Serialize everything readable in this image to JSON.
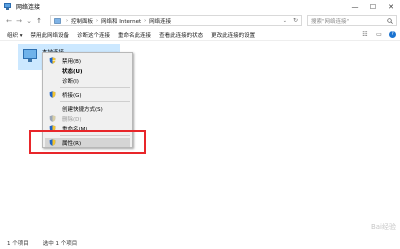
{
  "window": {
    "title": "网络连接",
    "minimize": "—",
    "maximize": "☐",
    "close": "✕"
  },
  "nav": {
    "back": "←",
    "forward": "→",
    "recent": "⌄",
    "up": "↑"
  },
  "address": {
    "crumbs": [
      "控制面板",
      "网络和 Internet",
      "网络连接"
    ],
    "separator": "›"
  },
  "search": {
    "placeholder": "搜索\"网络连接\""
  },
  "toolbar": {
    "items": [
      "组织 ▾",
      "禁用此网络设备",
      "诊断这个连接",
      "重命名此连接",
      "查看此连接的状态",
      "更改此连接的设置"
    ],
    "view_label": "☷",
    "pane_label": "▭",
    "help_label": "?"
  },
  "adapter": {
    "name": "本地连接"
  },
  "context_menu": {
    "items": [
      {
        "label": "禁用(B)",
        "shield": true,
        "disabled": false,
        "bold": false
      },
      {
        "label": "状态(U)",
        "shield": false,
        "disabled": false,
        "bold": true
      },
      {
        "label": "诊断(I)",
        "shield": false,
        "disabled": false,
        "bold": false
      },
      {
        "label": "桥接(G)",
        "shield": true,
        "disabled": false,
        "bold": false
      },
      {
        "label": "创建快捷方式(S)",
        "shield": false,
        "disabled": false,
        "bold": false
      },
      {
        "label": "删除(D)",
        "shield": true,
        "disabled": true,
        "bold": false
      },
      {
        "label": "重命名(M)",
        "shield": true,
        "disabled": false,
        "bold": false
      },
      {
        "label": "属性(R)",
        "shield": true,
        "disabled": false,
        "bold": false
      }
    ]
  },
  "status": {
    "count": "1 个项目",
    "selected": "选中 1 个项目"
  },
  "colors": {
    "selection": "#cce8ff",
    "highlight_box": "#e8262a",
    "menu_bg": "#f0f0f0",
    "menu_hover": "#d5d5d5"
  },
  "watermark": "Bai经验"
}
